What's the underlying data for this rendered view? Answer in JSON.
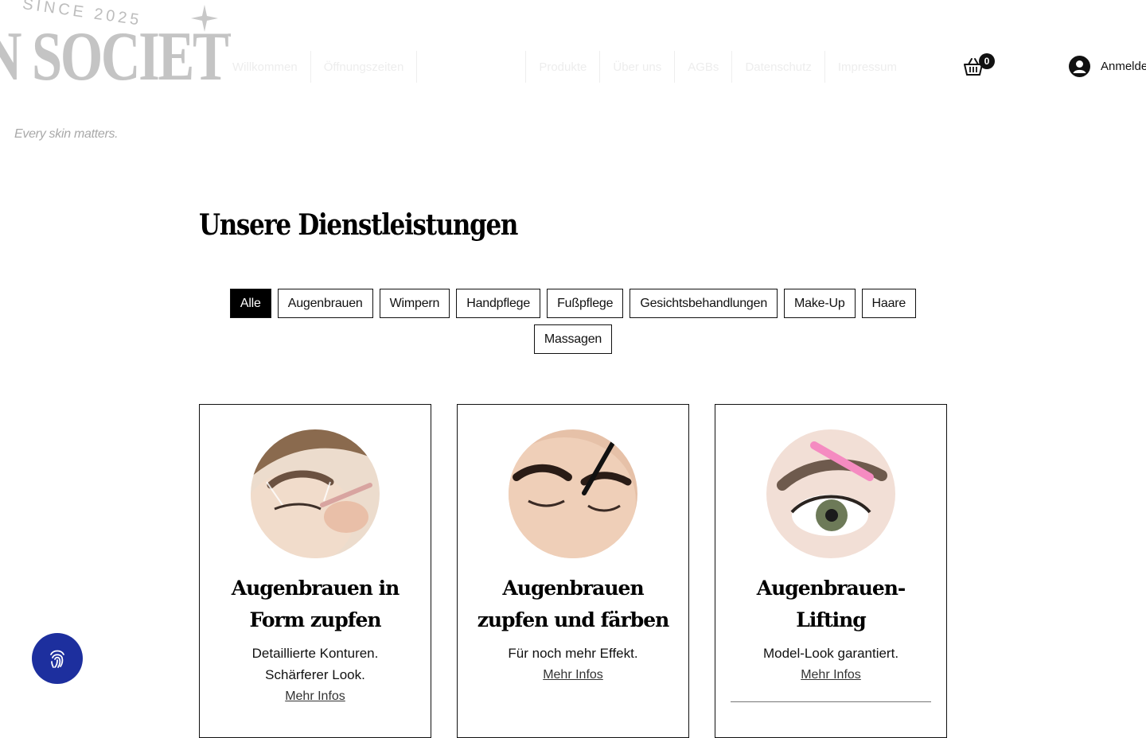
{
  "header": {
    "since_text": "SINCE 2025",
    "brand_text": "N SOCIETY",
    "tagline": "Every skin matters.",
    "nav": [
      {
        "label": "Willkommen"
      },
      {
        "label": "Öffnungszeiten"
      },
      {
        "label": ""
      },
      {
        "label": "Produkte"
      },
      {
        "label": "Über uns"
      },
      {
        "label": "AGBs"
      },
      {
        "label": "Datenschutz"
      },
      {
        "label": "Impressum"
      }
    ],
    "cart_count": "0",
    "login_label": "Anmelde"
  },
  "main": {
    "title": "Unsere Dienstleistungen",
    "filters": [
      "Alle",
      "Augenbrauen",
      "Wimpern",
      "Handpflege",
      "Fußpflege",
      "Gesichtsbehandlungen",
      "Make-Up",
      "Haare",
      "Massagen"
    ],
    "active_filter": "Alle",
    "cards": [
      {
        "title": "Augenbrauen in Form zupfen",
        "description": "Detaillierte Konturen. Schärferer Look.",
        "link": "Mehr Infos"
      },
      {
        "title": "Augenbrauen zupfen und färben",
        "description": "Für noch mehr Effekt.",
        "link": "Mehr Infos"
      },
      {
        "title": "Augenbrauen-Lifting",
        "description": "Model-Look garantiert.",
        "link": "Mehr Infos"
      }
    ]
  },
  "colors": {
    "accent_button": "#1d2f9e",
    "active_chip": "#000000",
    "logo_gray": "#c4c4c4"
  },
  "icons": {
    "cart": "shopping-basket-icon",
    "login": "account-icon",
    "fab": "fingerprint-icon"
  }
}
